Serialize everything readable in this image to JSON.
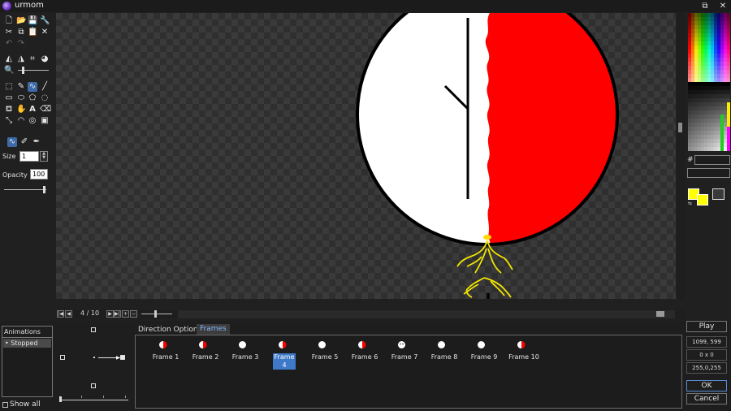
{
  "window": {
    "title": "urmom",
    "restore_glyph": "⧉",
    "close_glyph": "✕"
  },
  "tools": {
    "size_label": "Size",
    "size_value": "1",
    "opacity_label": "Opacity",
    "opacity_value": "100"
  },
  "timeline": {
    "frame_counter": "4 / 10",
    "first": "|◀",
    "prev": "◀",
    "next": "▶",
    "last": "▶|",
    "add": "+",
    "remove": "−"
  },
  "animations": {
    "title": "Animations",
    "items": [
      "• Stopped"
    ],
    "show_all": "Show all"
  },
  "tabs": {
    "direction": "Direction Options",
    "frames": "Frames"
  },
  "frames": [
    {
      "label": "Frame 1"
    },
    {
      "label": "Frame 2"
    },
    {
      "label": "Frame 3"
    },
    {
      "label": "Frame 4"
    },
    {
      "label": "Frame 5"
    },
    {
      "label": "Frame 6"
    },
    {
      "label": "Frame 7"
    },
    {
      "label": "Frame 8"
    },
    {
      "label": "Frame 9"
    },
    {
      "label": "Frame 10"
    }
  ],
  "selected_frame": 4,
  "right_panel": {
    "play": "Play",
    "resolution": "1099, 599",
    "offset": "0 x 0",
    "color_value": "255,0,255",
    "ok": "OK",
    "cancel": "Cancel",
    "hash": "#"
  },
  "colors": {
    "primary": "#ffff00",
    "secondary": "#ffff00",
    "accent": "#3e78c8",
    "red": "#ff0000"
  }
}
